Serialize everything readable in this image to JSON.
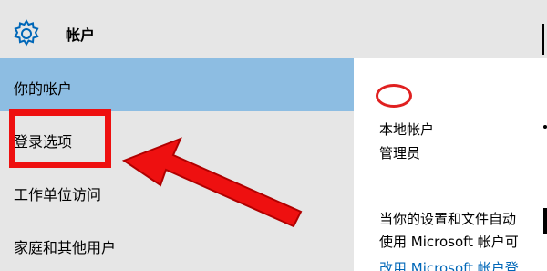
{
  "header": {
    "title": "帐户",
    "icon": "gear-icon"
  },
  "sidebar": {
    "items": [
      {
        "label": "你的帐户",
        "selected": true
      },
      {
        "label": "登录选项",
        "selected": false
      },
      {
        "label": "工作单位访问",
        "selected": false
      },
      {
        "label": "家庭和其他用户",
        "selected": false
      }
    ]
  },
  "main": {
    "account_type": "本地帐户",
    "account_role": "管理员",
    "description_line1": "当你的设置和文件自动",
    "description_line2": "使用 Microsoft 帐户可",
    "link": "改用 Microsoft 帐户登"
  },
  "annotation": {
    "color": "#ee1010"
  },
  "colors": {
    "selected_bg": "#8dbde2",
    "panel_bg": "#e6e6e6",
    "accent": "#0067b8"
  }
}
